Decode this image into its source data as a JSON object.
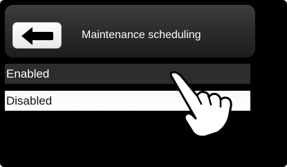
{
  "header": {
    "title": "Maintenance scheduling"
  },
  "options": [
    {
      "label": "Enabled"
    },
    {
      "label": "Disabled"
    }
  ],
  "icons": {
    "back": "left-arrow-icon",
    "pointer": "hand-pointer-icon"
  },
  "colors": {
    "background": "#000000",
    "header": "#2a2a2a",
    "enabled_row": "#2d2d2d",
    "disabled_row": "#ffffff",
    "text_light": "#ffffff",
    "text_dark": "#111111"
  }
}
